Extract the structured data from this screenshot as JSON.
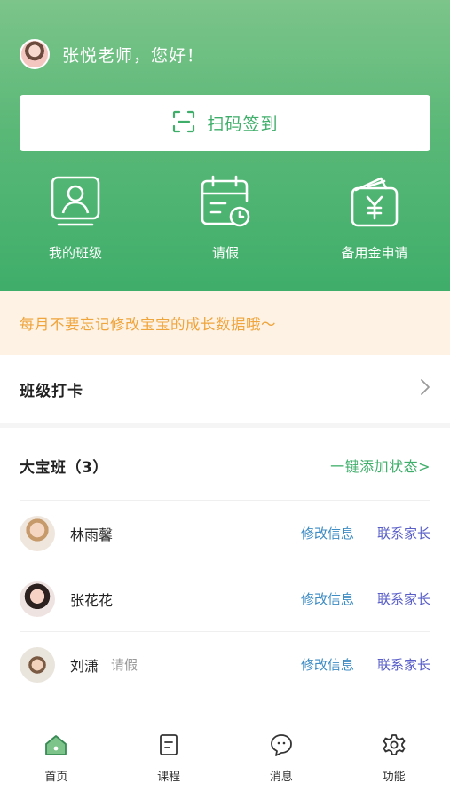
{
  "header": {
    "greeting": "张悦老师，您好！",
    "scan_button_label": "扫码签到"
  },
  "quick_actions": [
    {
      "label": "我的班级",
      "icon": "class-icon"
    },
    {
      "label": "请假",
      "icon": "leave-calendar-icon"
    },
    {
      "label": "备用金申请",
      "icon": "wallet-yen-icon"
    }
  ],
  "notice": {
    "text": "每月不要忘记修改宝宝的成长数据哦～"
  },
  "checkin": {
    "title": "班级打卡"
  },
  "class_section": {
    "name": "大宝班（3）",
    "add_status_label": "一键添加状态>",
    "students": [
      {
        "name": "林雨馨",
        "status": "",
        "edit_label": "修改信息",
        "contact_label": "联系家长"
      },
      {
        "name": "张花花",
        "status": "",
        "edit_label": "修改信息",
        "contact_label": "联系家长"
      },
      {
        "name": "刘潇",
        "status": "请假",
        "edit_label": "修改信息",
        "contact_label": "联系家长"
      }
    ]
  },
  "tabbar": {
    "items": [
      {
        "label": "首页",
        "icon": "home-icon",
        "active": true
      },
      {
        "label": "课程",
        "icon": "course-document-icon",
        "active": false
      },
      {
        "label": "消息",
        "icon": "message-bubble-icon",
        "active": false
      },
      {
        "label": "功能",
        "icon": "gear-icon",
        "active": false
      }
    ]
  },
  "colors": {
    "brand_green": "#3fae6a",
    "notice_text": "#f0a43c",
    "notice_bg": "#fdf2e4",
    "edit_link": "#3d8cc4",
    "contact_link": "#5a5fc8"
  }
}
